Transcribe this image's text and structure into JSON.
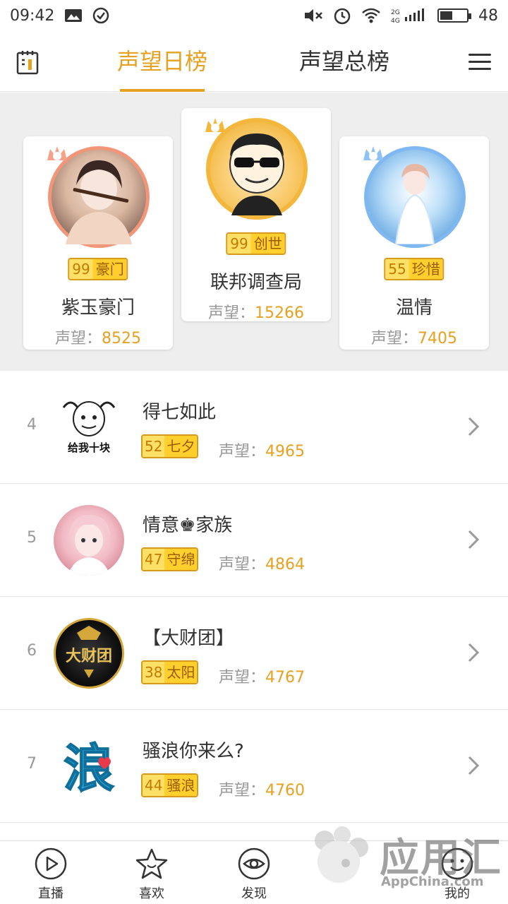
{
  "status_bar": {
    "time": "09:42",
    "battery": "48",
    "battery_level": 0.48
  },
  "header": {
    "tab_daily": "声望日榜",
    "tab_total": "声望总榜",
    "active_tab": "tab_daily"
  },
  "podium": {
    "first": {
      "rank_label": "1",
      "level": "99",
      "tag": "创世",
      "name": "联邦调查局",
      "score_label": "声望：",
      "score": "15266"
    },
    "second": {
      "rank_label": "2",
      "level": "99",
      "tag": "豪门",
      "name": "紫玉豪门",
      "score_label": "声望：",
      "score": "8525"
    },
    "third": {
      "rank_label": "3",
      "level": "55",
      "tag": "珍惜",
      "name": "温情",
      "score_label": "声望：",
      "score": "7405"
    }
  },
  "list": [
    {
      "rank": "4",
      "name": "得七如此",
      "level": "52",
      "tag": "七夕",
      "score_label": "声望：",
      "score": "4965",
      "avatar_text": "给我十块"
    },
    {
      "rank": "5",
      "name": "情意♚家族",
      "level": "47",
      "tag": "守绵",
      "score_label": "声望：",
      "score": "4864"
    },
    {
      "rank": "6",
      "name": "【大财团】",
      "level": "38",
      "tag": "太阳",
      "score_label": "声望：",
      "score": "4767",
      "avatar_text": "大财团"
    },
    {
      "rank": "7",
      "name": "骚浪你来么?",
      "level": "44",
      "tag": "骚浪",
      "score_label": "声望：",
      "score": "4760",
      "avatar_text": "浪"
    }
  ],
  "bottom_nav": {
    "live": "直播",
    "fav": "喜欢",
    "discover": "发现",
    "mine": "我的"
  },
  "watermark": {
    "title": "应用汇",
    "sub": "AppChina.com"
  },
  "colors": {
    "accent": "#e6a122",
    "badge_bg": "#ffcf2e",
    "divider": "#e6e6e6"
  }
}
